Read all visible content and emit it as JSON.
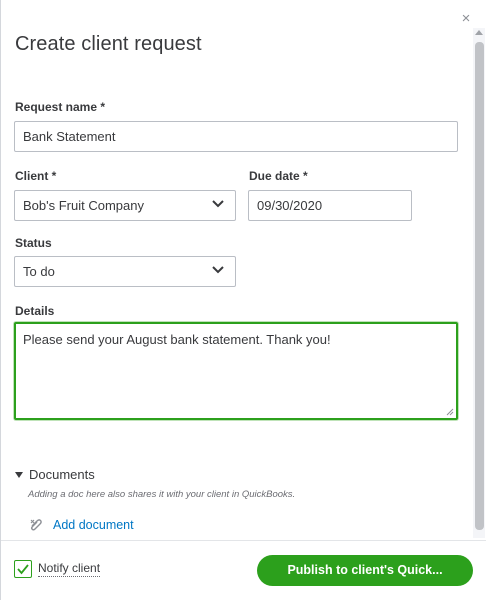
{
  "dialog": {
    "title": "Create client request",
    "close_glyph": "×"
  },
  "form": {
    "request_name": {
      "label": "Request name *",
      "value": "Bank Statement"
    },
    "client": {
      "label": "Client *",
      "value": "Bob's Fruit Company"
    },
    "due_date": {
      "label": "Due date *",
      "value": "09/30/2020"
    },
    "status": {
      "label": "Status",
      "value": "To do"
    },
    "details": {
      "label": "Details",
      "value": "Please send your August bank statement. Thank you!"
    }
  },
  "documents": {
    "header": "Documents",
    "note": "Adding a doc here also shares it with your client in QuickBooks.",
    "add_label": "Add document",
    "icon": "paperclip-icon"
  },
  "footer": {
    "notify_label": "Notify client",
    "notify_checked": true,
    "publish_label": "Publish to client's Quick..."
  },
  "colors": {
    "primary_green": "#2ca01c",
    "link_blue": "#0077c5",
    "text": "#393a3d"
  }
}
